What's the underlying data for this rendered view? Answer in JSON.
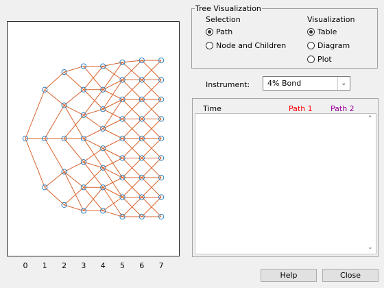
{
  "colors": {
    "edge": "#d9622b",
    "node": "#2a7fc0",
    "path1": "#ff0000",
    "path2": "#9b009b"
  },
  "chart_data": {
    "type": "tree",
    "x_ticks": [
      "0",
      "1",
      "2",
      "3",
      "4",
      "5",
      "6",
      "7"
    ],
    "levels": [
      {
        "t": 0,
        "nodes": [
          0
        ]
      },
      {
        "t": 1,
        "nodes": [
          2.5,
          0,
          -2.5
        ]
      },
      {
        "t": 2,
        "nodes": [
          3.4,
          1.7,
          0,
          -1.7,
          -3.4
        ]
      },
      {
        "t": 3,
        "nodes": [
          3.7,
          2.5,
          1.2,
          0,
          -1.2,
          -2.5,
          -3.7
        ]
      },
      {
        "t": 4,
        "nodes": [
          3.7,
          2.5,
          1.5,
          0.5,
          -0.5,
          -1.5,
          -2.5,
          -3.7
        ]
      },
      {
        "t": 5,
        "nodes": [
          3.9,
          3.0,
          2.0,
          1.0,
          0,
          -1.0,
          -2.0,
          -3.0,
          -4.0
        ]
      },
      {
        "t": 6,
        "nodes": [
          4.0,
          3.0,
          2.0,
          1.0,
          0,
          -1.0,
          -2.0,
          -3.0,
          -4.0
        ]
      },
      {
        "t": 7,
        "nodes": [
          4.0,
          3.0,
          2.0,
          1.0,
          0,
          -1.0,
          -2.0,
          -3.0,
          -4.0
        ]
      }
    ],
    "ylim": [
      -4.5,
      4.5
    ]
  },
  "tree_visualization": {
    "title": "Tree Visualization",
    "selection": {
      "label": "Selection",
      "options": [
        {
          "label": "Path",
          "checked": true
        },
        {
          "label": "Node and Children",
          "checked": false
        }
      ]
    },
    "visualization": {
      "label": "Visualization",
      "options": [
        {
          "label": "Table",
          "checked": true
        },
        {
          "label": "Diagram",
          "checked": false
        },
        {
          "label": "Plot",
          "checked": false
        }
      ]
    }
  },
  "instrument": {
    "label": "Instrument:",
    "value": "4% Bond"
  },
  "table": {
    "columns": [
      "Time",
      "Path 1",
      "Path 2"
    ]
  },
  "buttons": {
    "help": "Help",
    "close": "Close"
  }
}
